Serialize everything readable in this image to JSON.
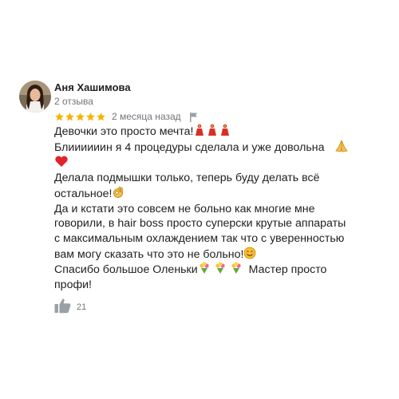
{
  "review": {
    "author": {
      "name": "Аня Хашимова",
      "review_count": "2 отзыва"
    },
    "rating": {
      "value": 5,
      "max": 5,
      "star_color": "#f4b400"
    },
    "date": "2 месяца назад",
    "body": {
      "line1": "Девочки это просто мечта!",
      "line2": "Блиииииин я 4 процедуры сделала и уже довольна",
      "line4": "Делала подмышки только, теперь буду делать всё",
      "line5": "остальное!",
      "line6": "Да и кстати это совсем не больно как многие мне",
      "line7": "говорили, в hair boss просто суперски крутые аппараты",
      "line8": "с максимальным охлаждением так что с уверенностью",
      "line9": "вам могу сказать что это не больно!",
      "line10a": "Спасибо большое Оленьки",
      "line10b": "Мастер просто",
      "line11": "профи!"
    },
    "emojis": [
      "woman-dancing",
      "woman-dancing",
      "woman-dancing",
      "folded-hands",
      "red-heart",
      "ok-hand",
      "smiling-face",
      "bouquet",
      "bouquet",
      "bouquet"
    ],
    "likes": {
      "count": "21"
    }
  }
}
